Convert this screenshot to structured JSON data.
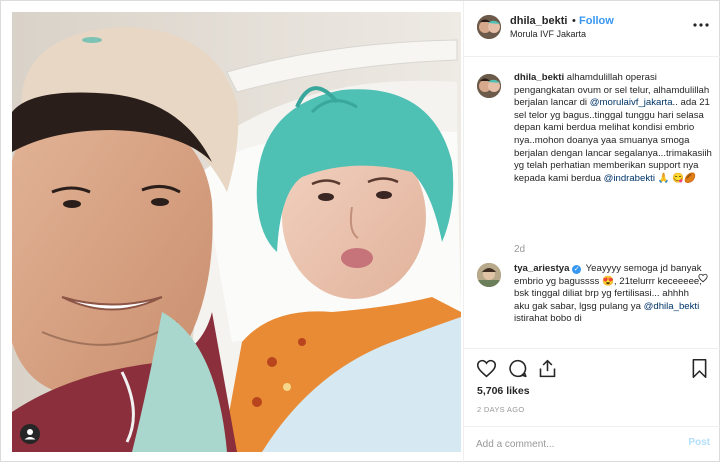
{
  "header": {
    "username": "dhila_bekti",
    "separator": "•",
    "follow_label": "Follow",
    "location": "Morula IVF Jakarta"
  },
  "caption": {
    "username": "dhila_bekti",
    "text_1": "alhamdulillah operasi pengangkatan ovum or sel telur, alhamdulillah berjalan lancar di",
    "mention_1": "@morulaivf_jakarta",
    "text_2": ".. ada 21 sel telor yg bagus..tinggal tunggu hari selasa depan kami berdua melihat kondisi embrio nya..mohon doanya yaa smuanya smoga berjalan dengan lancar segalanya...trimakasiih yg telah perhatian memberikan support nya kepada kami berdua",
    "mention_2": "@indrabekti",
    "emoji_1": "🙏",
    "emoji_2": "😋🏉",
    "time": "2d"
  },
  "comment": {
    "username": "tya_ariestya",
    "verified_glyph": "✓",
    "text_1": "Yeayyyy semoga jd banyak embrio yg bagussss 😍, 21telurrr keceeeee, bsk tinggal diliat brp yg fertilisasi... ahhhh aku gak sabar, lgsg pulang ya",
    "mention": "@dhila_bekti",
    "text_2": "istirahat bobo di"
  },
  "stats": {
    "likes": "5,706 likes",
    "date": "2 DAYS AGO"
  },
  "add_comment": {
    "placeholder": "Add a comment...",
    "post_label": "Post"
  },
  "icons": {
    "like": "heart-icon",
    "comment": "comment-icon",
    "share": "share-icon",
    "save": "bookmark-icon",
    "more": "more-options-icon",
    "user_tag": "user-tag-icon"
  },
  "colors": {
    "accent": "#3897f0",
    "mention": "#003569",
    "muted": "#999999",
    "border": "#efefef",
    "post_disabled": "#b2dffc"
  }
}
